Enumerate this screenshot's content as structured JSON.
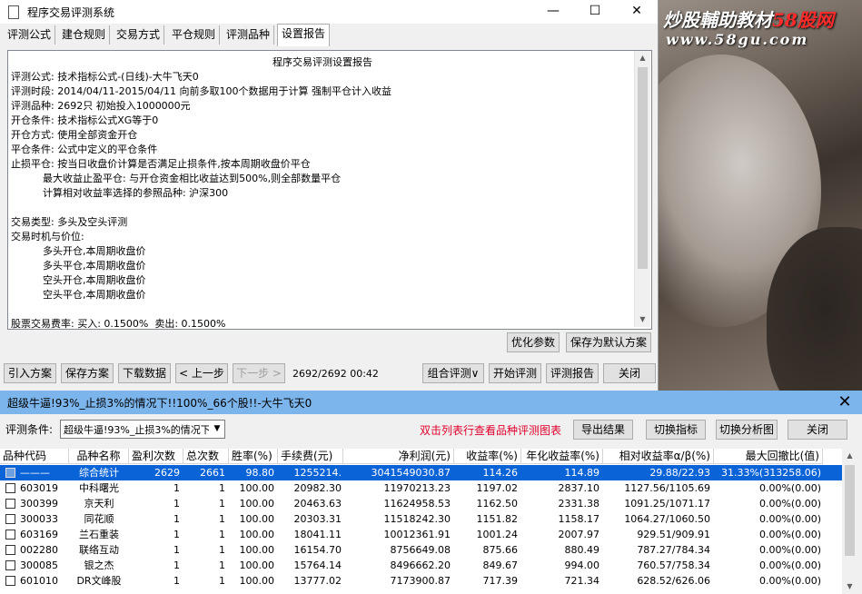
{
  "watermark": {
    "line1_a": "炒股輔助教材",
    "line1_b": "58股网",
    "line2": "www.58gu.com"
  },
  "window1": {
    "title": "程序交易评测系统",
    "controls": {
      "minimize": "—",
      "maximize": "☐",
      "close": "✕"
    },
    "tabs": [
      "评测公式",
      "建仓规则",
      "交易方式",
      "平仓规则",
      "评测品种",
      "设置报告"
    ],
    "report": {
      "title": "程序交易评测设置报告",
      "lines": [
        "评测公式: 技术指标公式-(日线)-大牛飞天0",
        "评测时段: 2014/04/11-2015/04/11 向前多取100个数据用于计算 强制平仓计入收益",
        "评测品种: 2692只 初始投入1000000元",
        "开仓条件: 技术指标公式XG等于0",
        "开仓方式: 使用全部资金开仓",
        "平仓条件: 公式中定义的平仓条件",
        "止损平仓: 按当日收盘价计算是否满足止损条件,按本周期收盘价平仓",
        "          最大收益止盈平仓: 与开仓资金相比收益达到500%,则全部数量平仓",
        "          计算相对收益率选择的参照品种: 沪深300",
        "",
        "交易类型: 多头及空头评测",
        "交易时机与价位:",
        "          多头开仓,本周期收盘价",
        "          多头平仓,本周期收盘价",
        "          空头开仓,本周期收盘价",
        "          空头平仓,本周期收盘价",
        "",
        "股票交易费率: 买入: 0.1500%  卖出: 0.1500%"
      ]
    },
    "buttons": {
      "optimize": "优化参数",
      "save_default": "保存为默认方案",
      "import": "引入方案",
      "save": "保存方案",
      "download": "下载数据",
      "prev": "< 上一步",
      "next": "下一步 >",
      "progress": "2692/2692 00:42",
      "combo": "组合评测∨",
      "start": "开始评测",
      "report": "评测报告",
      "close": "关闭"
    }
  },
  "window2": {
    "title": "超级牛逼!93%_止损3%的情况下!!100%_66个股!!-大牛飞天0",
    "close": "✕",
    "cond_label": "评测条件:",
    "cond_value": "超级牛逼!93%_止损3%的情况下!!100%_66个股!!",
    "hint": "双击列表行查看品种评测图表",
    "buttons": {
      "export": "导出结果",
      "switch_indicator": "切换指标",
      "switch_chart": "切换分析图",
      "close": "关闭"
    },
    "columns": [
      "品种代码",
      "品种名称",
      "盈利次数",
      "总次数",
      "胜率(%)",
      "手续费(元)",
      "净利润(元)",
      "收益率(%)",
      "年化收益率(%)",
      "相对收益率α/β(%)",
      "最大回撤比(值)"
    ],
    "rows": [
      [
        "———",
        "综合统计",
        "2629",
        "2661",
        "98.80",
        "1255214.",
        "3041549030.87",
        "114.26",
        "114.89",
        "29.88/22.93",
        "31.33%(313258.06)"
      ],
      [
        "603019",
        "中科曙光",
        "1",
        "1",
        "100.00",
        "20982.30",
        "11970213.23",
        "1197.02",
        "2837.10",
        "1127.56/1105.69",
        "0.00%(0.00)"
      ],
      [
        "300399",
        "京天利",
        "1",
        "1",
        "100.00",
        "20463.63",
        "11624958.53",
        "1162.50",
        "2331.38",
        "1091.25/1071.17",
        "0.00%(0.00)"
      ],
      [
        "300033",
        "同花顺",
        "1",
        "1",
        "100.00",
        "20303.31",
        "11518242.30",
        "1151.82",
        "1158.17",
        "1064.27/1060.50",
        "0.00%(0.00)"
      ],
      [
        "603169",
        "兰石重装",
        "1",
        "1",
        "100.00",
        "18041.11",
        "10012361.91",
        "1001.24",
        "2007.97",
        "929.51/909.91",
        "0.00%(0.00)"
      ],
      [
        "002280",
        "联络互动",
        "1",
        "1",
        "100.00",
        "16154.70",
        "8756649.08",
        "875.66",
        "880.49",
        "787.27/784.34",
        "0.00%(0.00)"
      ],
      [
        "300085",
        "银之杰",
        "1",
        "1",
        "100.00",
        "15764.14",
        "8496662.20",
        "849.67",
        "994.00",
        "760.57/758.34",
        "0.00%(0.00)"
      ],
      [
        "601010",
        "DR文峰股",
        "1",
        "1",
        "100.00",
        "13777.02",
        "7173900.87",
        "717.39",
        "721.34",
        "628.52/626.06",
        "0.00%(0.00)"
      ]
    ]
  }
}
